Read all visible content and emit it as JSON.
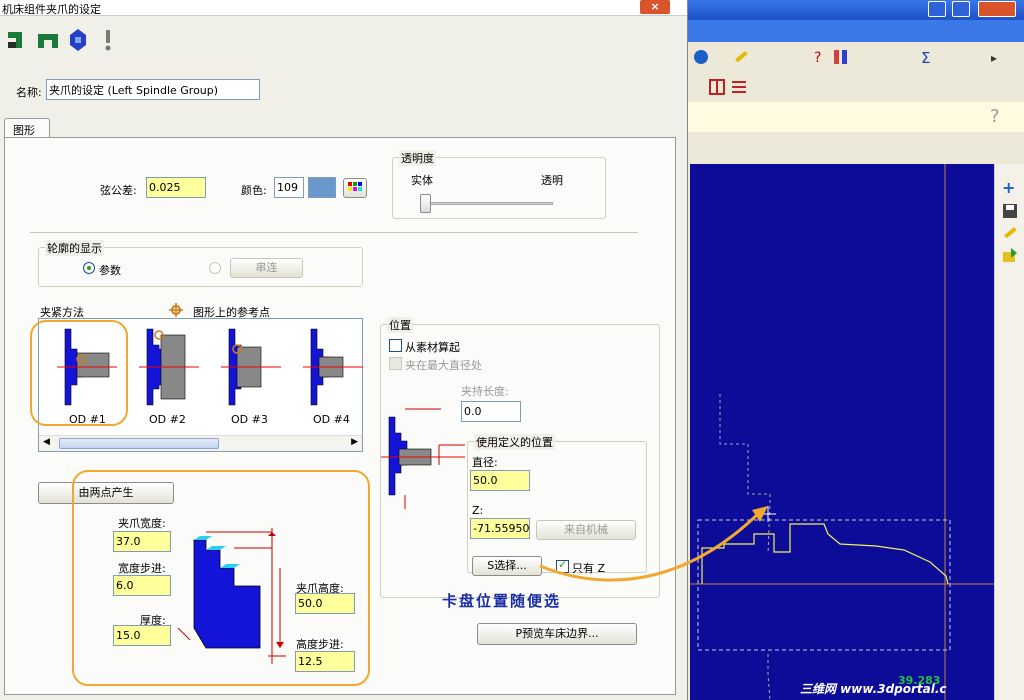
{
  "dialog": {
    "title": "机床组件夹爪的设定",
    "close_label": "×",
    "name_label": "名称:",
    "name_value": "夹爪的设定 (Left Spindle Group)",
    "tab_label": "图形",
    "tolerance_label": "弦公差:",
    "tolerance_value": "0.025",
    "color_label": "颜色:",
    "color_value": "109",
    "color_swatch": "#6b98cc",
    "transparency": {
      "title": "透明度",
      "solid_label": "实体",
      "transparent_label": "透明",
      "level": 0
    },
    "profile": {
      "title": "轮廓的显示",
      "param_label": "参数",
      "chain_label": "串连"
    },
    "clamp_method_label": "夹紧方法",
    "ref_point_label": "图形上的参考点",
    "clamp_options": [
      {
        "label": "OD #1"
      },
      {
        "label": "OD #2"
      },
      {
        "label": "OD #3"
      },
      {
        "label": "OD #4"
      }
    ],
    "two_point_button": "由两点产生",
    "jaw_width_label": "夹爪宽度:",
    "jaw_width_value": "37.0",
    "width_step_label": "宽度步进:",
    "width_step_value": "6.0",
    "thickness_label": "厚度:",
    "thickness_value": "15.0",
    "jaw_height_label": "夹爪高度:",
    "jaw_height_value": "50.0",
    "height_step_label": "高度步进:",
    "height_step_value": "12.5",
    "position": {
      "title": "位置",
      "from_stock_label": "从素材算起",
      "max_dia_label": "夹在最大直径处",
      "clamp_length_label": "夹持长度:",
      "clamp_length_value": "0.0",
      "user_pos_title": "使用定义的位置",
      "diameter_label": "直径:",
      "diameter_value": "50.0",
      "z_label": "Z:",
      "z_value": "-71.559501",
      "from_machine_label": "来自机械",
      "select_label": "S选择...",
      "only_z_label": "只有 Z"
    },
    "preview_button": "P预览车床边界...",
    "annotation_text": "卡盘位置随便选"
  },
  "app": {
    "readout": "39.283",
    "watermark": "三维网 www.3dportal.c"
  },
  "colors": {
    "blue_jaw": "#1414d8",
    "annotation": "#f0a830",
    "canvas": "#0c0c98"
  }
}
